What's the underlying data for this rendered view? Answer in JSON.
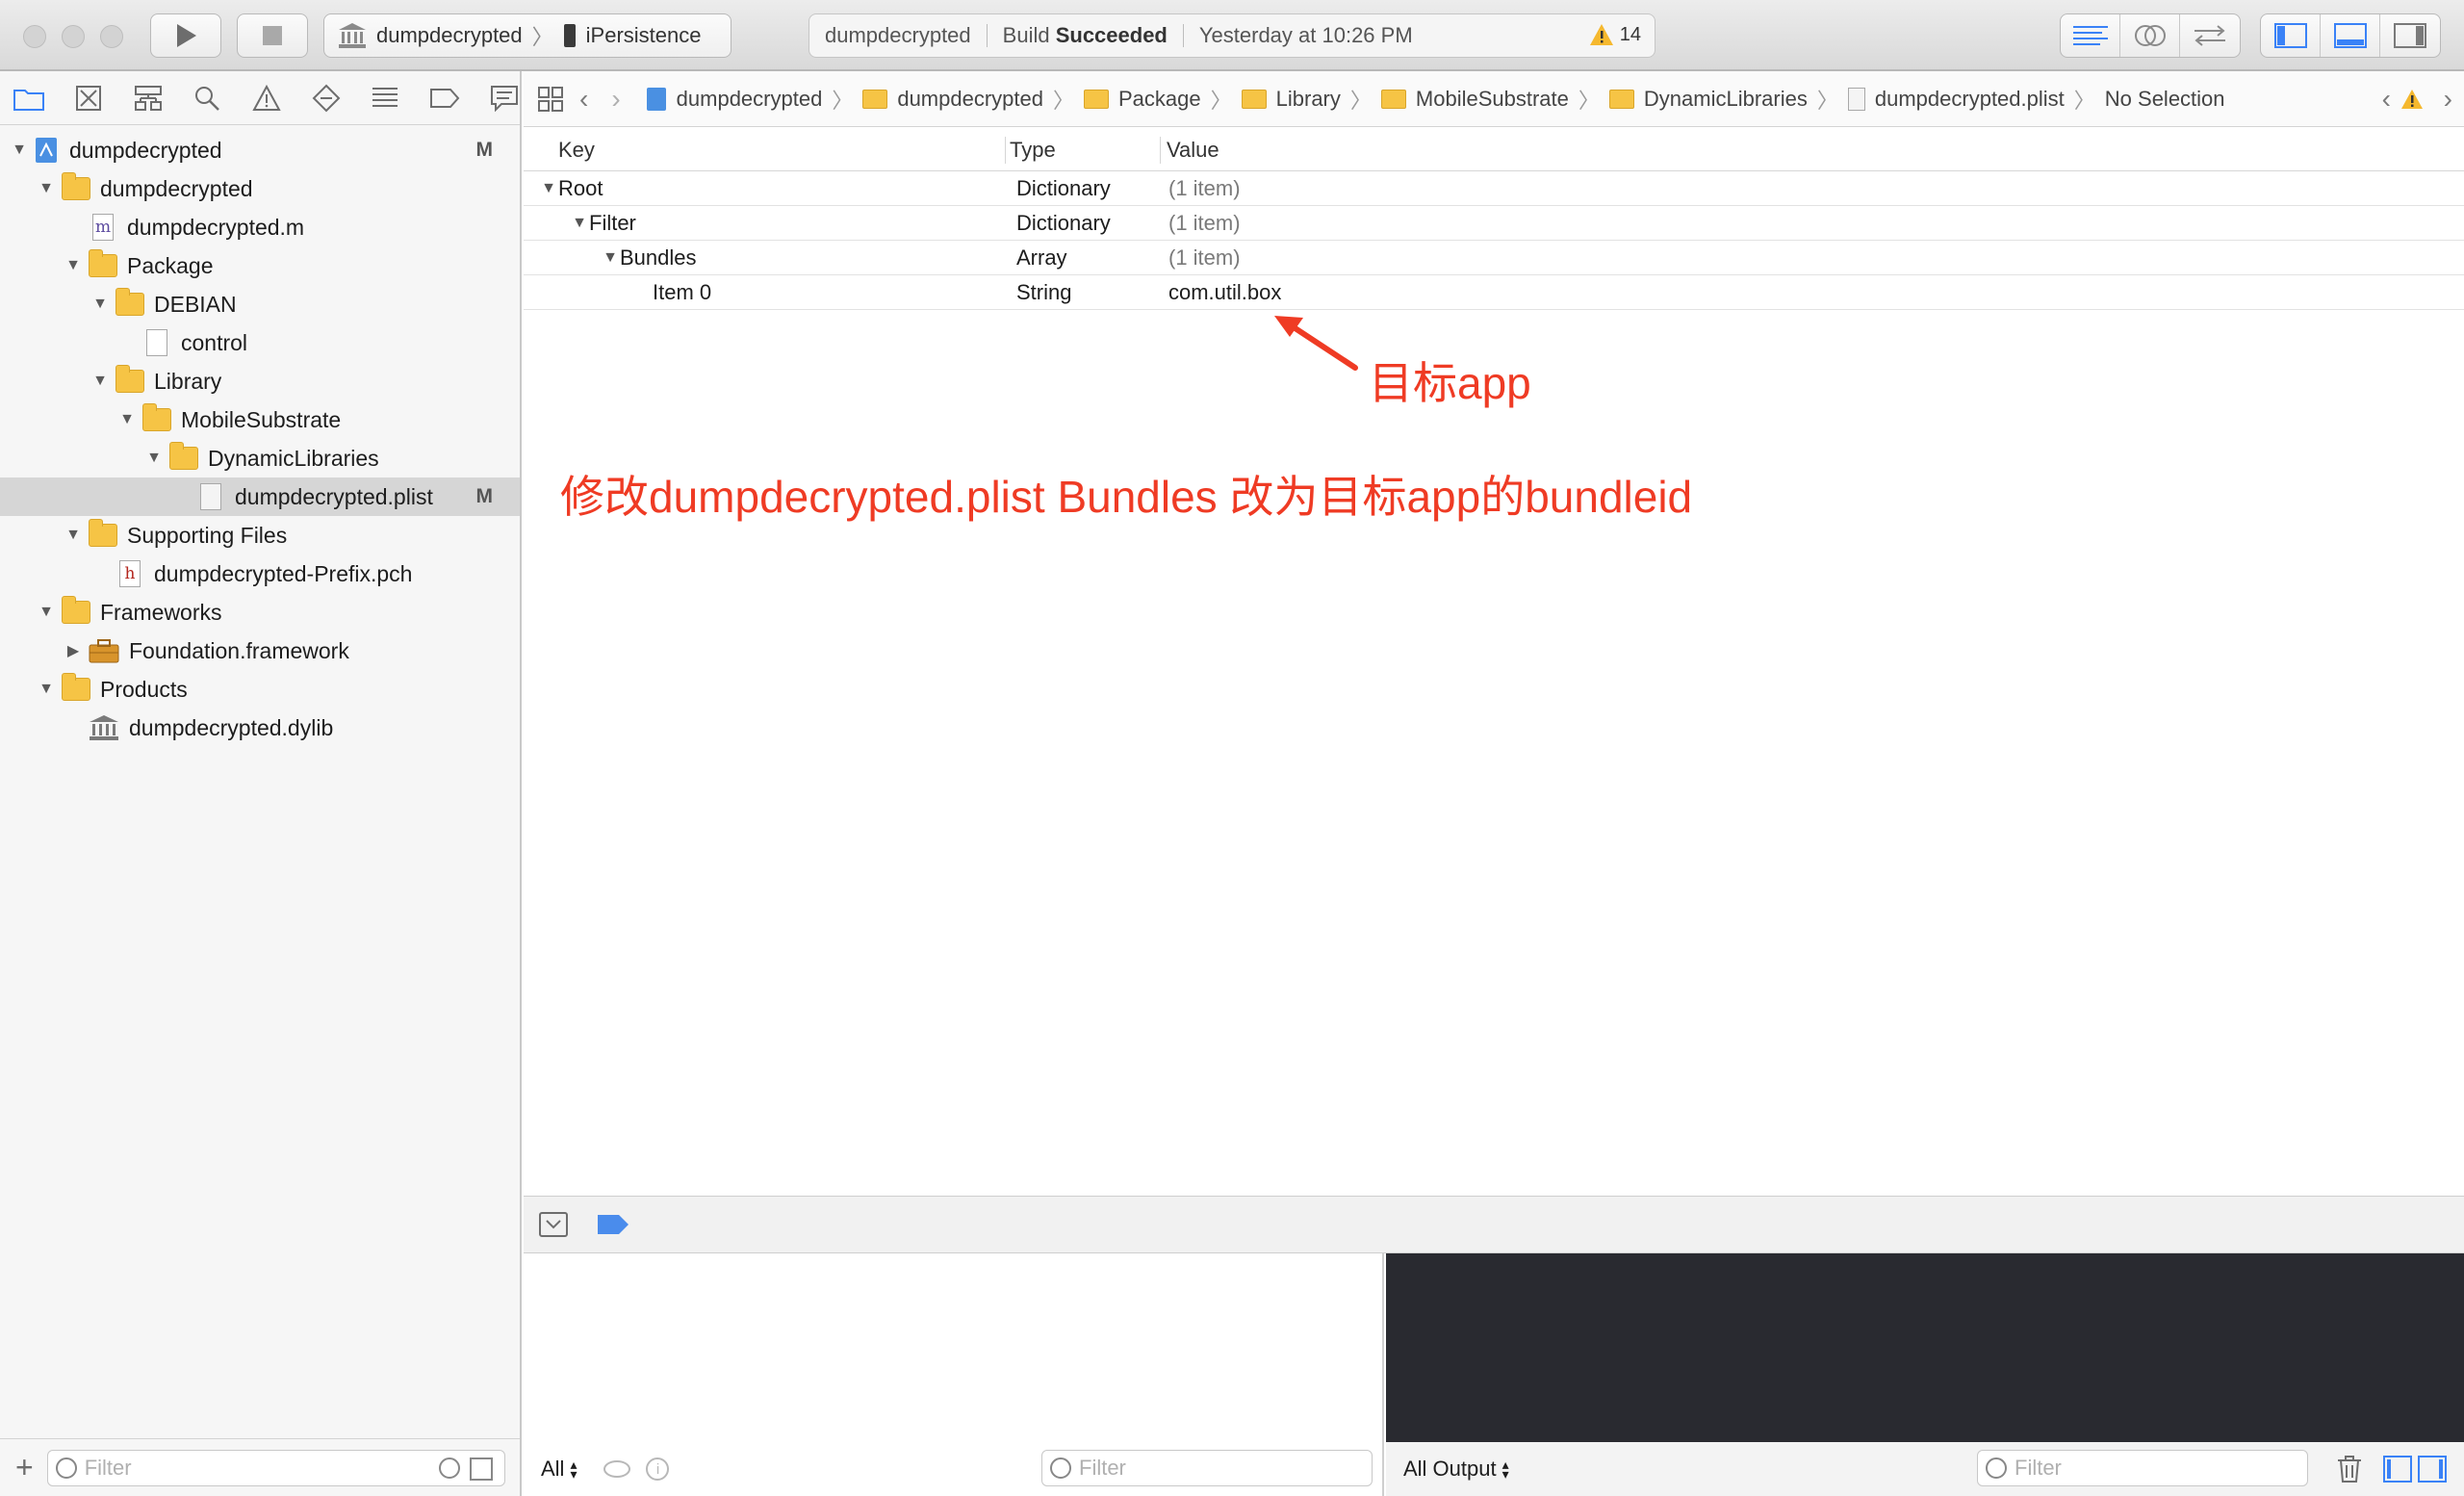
{
  "toolbar": {
    "scheme_name": "dumpdecrypted",
    "device_name": "iPersistence",
    "activity_project": "dumpdecrypted",
    "activity_status_prefix": "Build",
    "activity_status": "Succeeded",
    "activity_time": "Yesterday at 10:26 PM",
    "warning_count": "14"
  },
  "navigator": {
    "items": [
      {
        "label": "dumpdecrypted",
        "badge": "M"
      },
      {
        "label": "dumpdecrypted"
      },
      {
        "label": "dumpdecrypted.m",
        "icon_letter": "m"
      },
      {
        "label": "Package"
      },
      {
        "label": "DEBIAN"
      },
      {
        "label": "control"
      },
      {
        "label": "Library"
      },
      {
        "label": "MobileSubstrate"
      },
      {
        "label": "DynamicLibraries"
      },
      {
        "label": "dumpdecrypted.plist",
        "badge": "M"
      },
      {
        "label": "Supporting Files"
      },
      {
        "label": "dumpdecrypted-Prefix.pch",
        "icon_letter": "h"
      },
      {
        "label": "Frameworks"
      },
      {
        "label": "Foundation.framework"
      },
      {
        "label": "Products"
      },
      {
        "label": "dumpdecrypted.dylib"
      }
    ],
    "filter_placeholder": "Filter"
  },
  "jumpbar": {
    "crumbs": [
      "dumpdecrypted",
      "dumpdecrypted",
      "Package",
      "Library",
      "MobileSubstrate",
      "DynamicLibraries",
      "dumpdecrypted.plist",
      "No Selection"
    ]
  },
  "plist": {
    "headers": {
      "key": "Key",
      "type": "Type",
      "value": "Value"
    },
    "rows": [
      {
        "key": "Root",
        "type": "Dictionary",
        "value": "(1 item)"
      },
      {
        "key": "Filter",
        "type": "Dictionary",
        "value": "(1 item)"
      },
      {
        "key": "Bundles",
        "type": "Array",
        "value": "(1 item)"
      },
      {
        "key": "Item 0",
        "type": "String",
        "value": "com.util.box"
      }
    ]
  },
  "annotations": {
    "target_label": "目标app",
    "instruction": "修改dumpdecrypted.plist Bundles 改为目标app的bundleid"
  },
  "debug": {
    "variables_scope": "All",
    "variables_filter_placeholder": "Filter",
    "console_scope": "All Output",
    "console_filter_placeholder": "Filter"
  },
  "colors": {
    "annotation": "#ef3b24",
    "console_background": "#292a30",
    "folder": "#f6c445",
    "accent": "#3a82f7"
  }
}
